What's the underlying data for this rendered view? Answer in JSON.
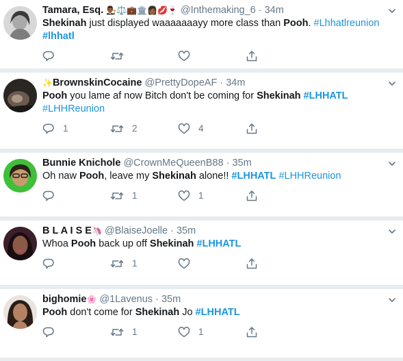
{
  "tweets": [
    {
      "name": "Tamara, Esq.",
      "name_emojis": "👨🏾‍⚖️⚖️💼🏛️👩🏾💋🍷",
      "handle": "@Inthemaking_6",
      "dot": "·",
      "time": "34m",
      "text": {
        "p1_bold": "Shekinah",
        "p2": " just displayed waaaaaaayy more class than ",
        "p3_bold": "Pooh",
        "p4": ". ",
        "hash1": "#Lhhatlreunion",
        "hash2": "#lhhatl"
      },
      "replies": "",
      "retweets": "",
      "likes": ""
    },
    {
      "name_prefix": "✨",
      "name": "BrownskinCocaine",
      "handle": "@PrettyDopeAF",
      "dot": "·",
      "time": "34m",
      "text": {
        "p1_bold": "Pooh",
        "p2": " you lame af now Bitch don't be coming for ",
        "p3_bold": "Shekinah",
        "p4": " ",
        "hash1": "#LHHATL",
        "hash2": "#LHHReunion"
      },
      "replies": "1",
      "retweets": "2",
      "likes": "4"
    },
    {
      "name": "Bunnie Knichole",
      "handle": "@CrownMeQueenB88",
      "dot": "·",
      "time": "35m",
      "text": {
        "p1": "Oh naw ",
        "p2_bold": "Pooh",
        "p3": ", leave my ",
        "p4_bold": "Shekinah",
        "p5": " alone!! ",
        "hash1": "#LHHATL",
        "hash2": "#LHHReunion"
      },
      "replies": "",
      "retweets": "1",
      "likes": "1"
    },
    {
      "name": "B L A I S E",
      "name_emojis": "🦄",
      "handle": "@BlaiseJoelle",
      "dot": "·",
      "time": "35m",
      "text": {
        "p1": "Whoa ",
        "p2_bold": "Pooh",
        "p3": " back up off ",
        "p4_bold": "Shekinah",
        "p5": " ",
        "hash1": "#LHHATL"
      },
      "replies": "",
      "retweets": "1",
      "likes": ""
    },
    {
      "name": "bighomie",
      "name_emojis": "🌸",
      "handle": "@1Lavenus",
      "dot": "·",
      "time": "35m",
      "text": {
        "p1_bold": "Pooh",
        "p2": " don't come for ",
        "p3_bold": "Shekinah",
        "p4": " Jo ",
        "hash1": "#LHHATL"
      },
      "replies": "",
      "retweets": "1",
      "likes": "1"
    }
  ],
  "colors": {
    "text": "#14171a",
    "secondary": "#657786",
    "link": "#1b95e0",
    "separator": "#e6ecf0"
  },
  "icons": [
    "reply-icon",
    "retweet-icon",
    "like-icon",
    "share-icon",
    "chevron-down-icon"
  ]
}
